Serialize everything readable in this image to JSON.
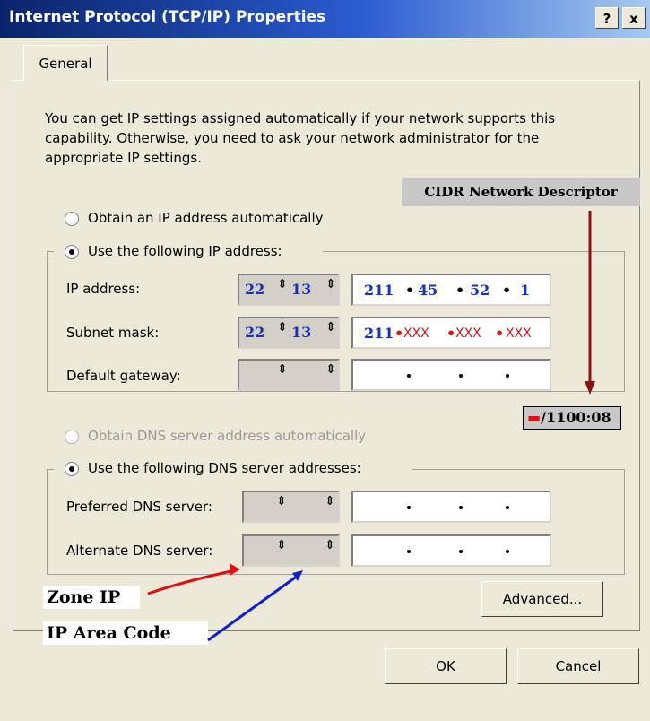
{
  "window": {
    "title": "Internet Protocol (TCP/IP) Properties",
    "help_label": "?",
    "close_label": "x"
  },
  "tab": {
    "label": "General"
  },
  "intro": "You can get IP settings assigned automatically if your network supports this capability. Otherwise, you need to ask your network administrator for the appropriate IP settings.",
  "ip_section": {
    "auto_label": "Obtain an IP address automatically",
    "manual_label": "Use the following IP address:",
    "rows": [
      {
        "label": "IP address:",
        "zone": "22",
        "area": "13",
        "octets": [
          "211",
          "45",
          "52",
          "1"
        ]
      },
      {
        "label": "Subnet mask:",
        "zone": "22",
        "area": "13",
        "octets": [
          "211",
          "XXX",
          "XXX",
          "XXX"
        ]
      },
      {
        "label": "Default gateway:",
        "zone": "",
        "area": "",
        "octets": [
          "",
          "",
          "",
          ""
        ]
      }
    ]
  },
  "dns_section": {
    "auto_label": "Obtain DNS server address automatically",
    "manual_label": "Use the following DNS server addresses:",
    "rows": [
      {
        "label": "Preferred DNS server:"
      },
      {
        "label": "Alternate DNS server:"
      }
    ]
  },
  "buttons": {
    "advanced": "Advanced...",
    "ok": "OK",
    "cancel": "Cancel"
  },
  "annotations": {
    "cidr": "CIDR Network Descriptor",
    "cidr_value": "/1100:08",
    "zone_ip": "Zone IP",
    "ip_area_code": "IP Area Code"
  },
  "colors": {
    "title_start": "#0a246a",
    "title_end": "#a6caf0",
    "value_blue": "#1430c8",
    "mask_red": "#e01010",
    "arrow_red": "#e01010",
    "arrow_blue": "#1020d0",
    "arrow_dark_red": "#8b1010"
  }
}
